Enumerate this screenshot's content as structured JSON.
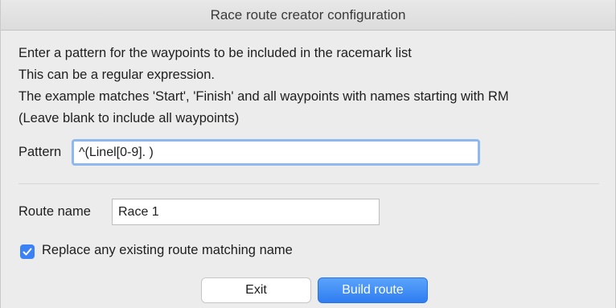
{
  "window": {
    "title": "Race route creator configuration"
  },
  "info": {
    "line1": "Enter a pattern for the waypoints to be included in the racemark list",
    "line2": "This can be a regular expression.",
    "line3": "The example matches 'Start', 'Finish' and all waypoints with names starting with RM",
    "line4": "(Leave blank to include all waypoints)"
  },
  "pattern": {
    "label": "Pattern",
    "value": "^(Linel[0-9]. )"
  },
  "route": {
    "label": "Route name",
    "value": "Race 1"
  },
  "replace": {
    "label": "Replace any existing route matching name",
    "checked": true
  },
  "buttons": {
    "exit_label": "Exit",
    "build_label": "Build route"
  },
  "colors": {
    "accent": "#3b82f6",
    "focus_ring": "#8fb8ee",
    "background": "#ececec"
  }
}
